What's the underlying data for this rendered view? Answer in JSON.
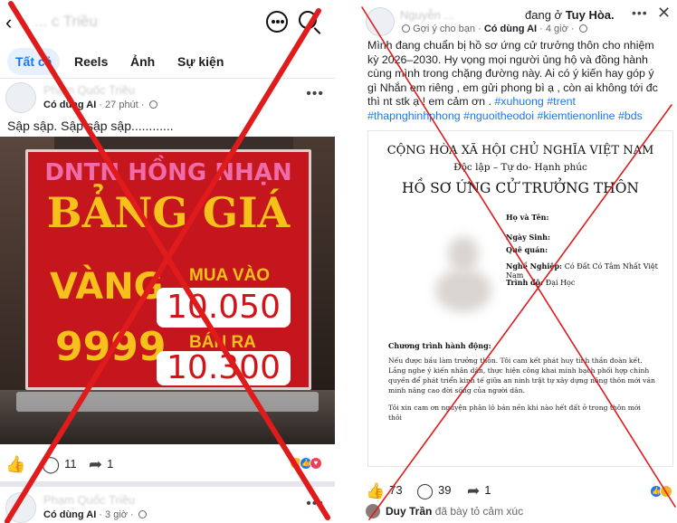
{
  "left": {
    "header": {
      "blurred_title": "... c Triều"
    },
    "tabs": [
      "Tất cả",
      "Reels",
      "Ảnh",
      "Sự kiện"
    ],
    "post1": {
      "author_blurred": "Phạm Quốc Triều",
      "tag": "Có dùng AI",
      "time": "27 phút",
      "text": "Sập sập. Sập sập sập............",
      "sign": {
        "shop": "DNTN HỒNG NHẠN",
        "title": "BẢNG GIÁ",
        "product1": "VÀNG",
        "product2": "9999",
        "buy_label": "MUA VÀO",
        "buy_price": "10.050",
        "sell_label": "BÁN RA",
        "sell_price": "10.300"
      },
      "comments": "11",
      "shares": "1"
    },
    "post2": {
      "author_blurred": "Phạm Quốc Triều",
      "tag": "Có dùng AI",
      "time": "3 giờ"
    }
  },
  "right": {
    "author_blurred": "Nguyễn ...",
    "location_prefix": "đang ở",
    "location": "Tuy Hòa.",
    "suggested": "Gợi ý cho bạn",
    "tag": "Có dùng AI",
    "time": "4 giờ",
    "text_lines": [
      "Mình đang chuẩn bị hồ sơ ứng cử trưởng thôn cho nhiệm",
      "kỳ 2026–2030. Hy vọng mọi người ủng hộ và đồng hành",
      "cùng mình trong chặng đường này. Ai có ý kiến hay góp ý",
      "gì Nhắn em riêng , em gửi phong bì ạ , còn ai không tới đc",
      "thì nt stk ạ ! em cảm ơn ."
    ],
    "hashtags_line1": [
      "#xuhuong",
      "#trent"
    ],
    "hashtags_line2": [
      "#thapnghinhphong",
      "#nguoitheodoi",
      "#kiemtienonline",
      "#bds"
    ],
    "document": {
      "line1": "CỘNG HÒA XÃ HỘI CHỦ NGHĨA VIỆT NAM",
      "line2": "Độc lập – Tự do- Hạnh phúc",
      "title": "HỒ SƠ ỨNG CỬ TRƯỞNG THÔN",
      "fields": [
        {
          "label": "Họ và Tên:",
          "value": ""
        },
        {
          "label": "Ngày Sinh:",
          "value": ""
        },
        {
          "label": "Quê quán:",
          "value": ""
        },
        {
          "label": "Nghề Nghiệp:",
          "value": "Có Đất Có Tâm Nhất Việt Nam"
        },
        {
          "label": "Trình độ:",
          "value": "Đại Học"
        }
      ],
      "section": "Chương trình hành động:",
      "para1": "Nếu được bầu làm trưởng thôn. Tôi cam kết phát huy tinh thần đoàn kết. Lắng nghe ý kiến nhân dân, thực hiện công khai minh bạch phối hợp chính quyền để phát triển kinh tế giữa an ninh trật tự xây dựng nông thôn mới văn minh nâng cao đời sống của người dân.",
      "para2": "Tôi xin cam ơn nguyện phân lô bán nền khi nào hết đất ở trong thôn mới thôi"
    },
    "likes": "73",
    "comments": "39",
    "shares": "1",
    "footer_name": "Duy Trần",
    "footer_text": "đã bày tỏ cảm xúc"
  },
  "colors": {
    "accent": "#1877f2",
    "x_mark": "#e01b1b",
    "sign_red": "#c4161c",
    "sign_gold": "#f5c11a",
    "sign_pink": "#f06ca8"
  },
  "icons": [
    "back-arrow-icon",
    "more-icon",
    "search-icon",
    "globe-icon",
    "like-icon",
    "comment-icon",
    "share-icon",
    "close-icon"
  ]
}
